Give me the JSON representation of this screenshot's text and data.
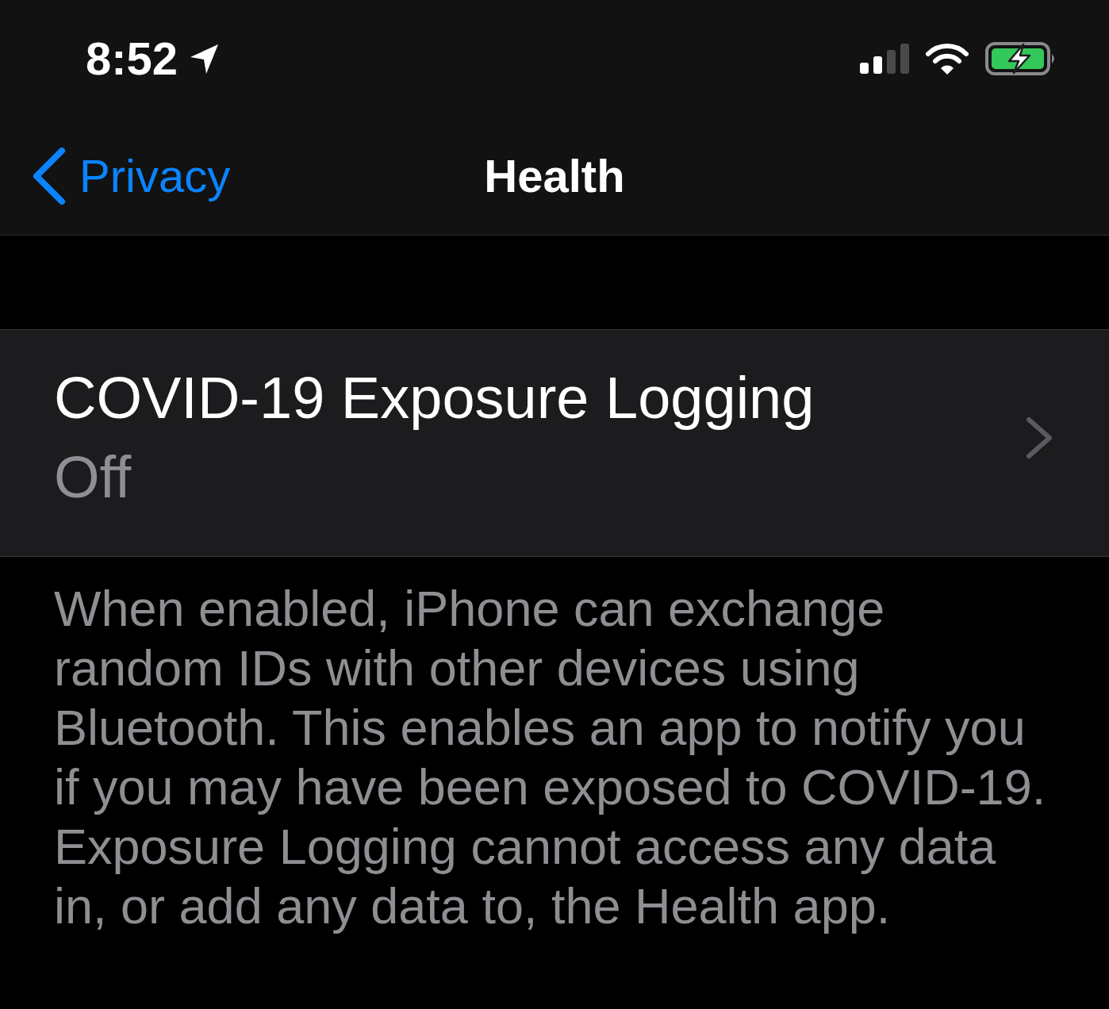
{
  "status_bar": {
    "time": "8:52"
  },
  "nav_bar": {
    "back_label": "Privacy",
    "title": "Health"
  },
  "rows": [
    {
      "title": "COVID-19 Exposure Logging",
      "value": "Off"
    }
  ],
  "footer_note": "When enabled, iPhone can exchange random IDs with other devices using Bluetooth. This enables an app to notify you if you may have been exposed to COVID-19. Exposure Logging cannot access any data in, or add any data to, the Health app."
}
